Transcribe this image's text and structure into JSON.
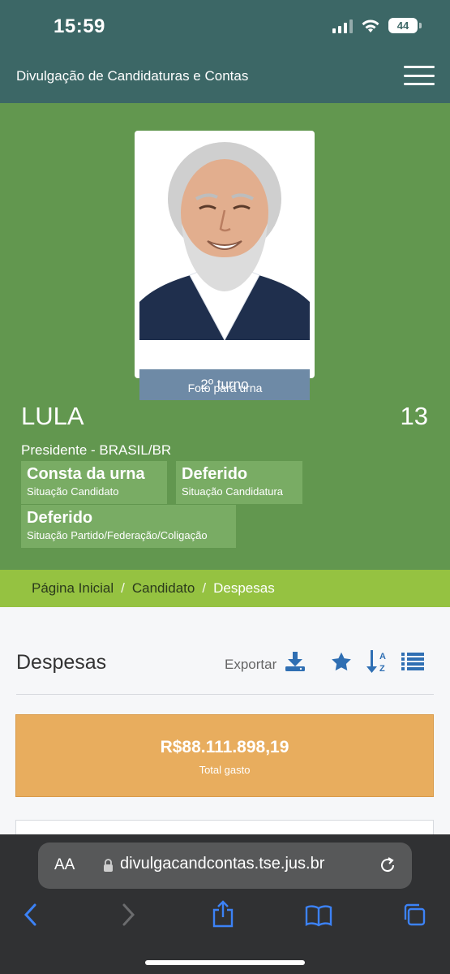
{
  "status_bar": {
    "time": "15:59",
    "battery": "44"
  },
  "header": {
    "title": "Divulgação de Candidaturas e Contas"
  },
  "candidate": {
    "turno_label": "2º turno",
    "photo_caption": "Foto para urna",
    "name": "LULA",
    "number": "13",
    "cargo": "Presidente - BRASIL/BR",
    "badges": [
      {
        "value": "Consta da urna",
        "label": "Situação Candidato"
      },
      {
        "value": "Deferido",
        "label": "Situação Candidatura"
      },
      {
        "value": "Deferido",
        "label": "Situação Partido/Federação/Coligação"
      }
    ]
  },
  "breadcrumb": {
    "items": [
      "Página Inicial",
      "Candidato",
      "Despesas"
    ],
    "separator": "/"
  },
  "despesas": {
    "title": "Despesas",
    "export_label": "Exportar",
    "total_value": "R$88.111.898,19",
    "total_label": "Total gasto"
  },
  "browser": {
    "aa_label": "AA",
    "url": "divulgacandcontas.tse.jus.br"
  },
  "colors": {
    "header": "#3c6766",
    "candidate_bg": "#62974f",
    "breadcrumb_bg": "#95c241",
    "total_bg": "#e8ad5e",
    "icon_blue": "#2f6fb3",
    "safari_blue": "#3c82f6"
  }
}
